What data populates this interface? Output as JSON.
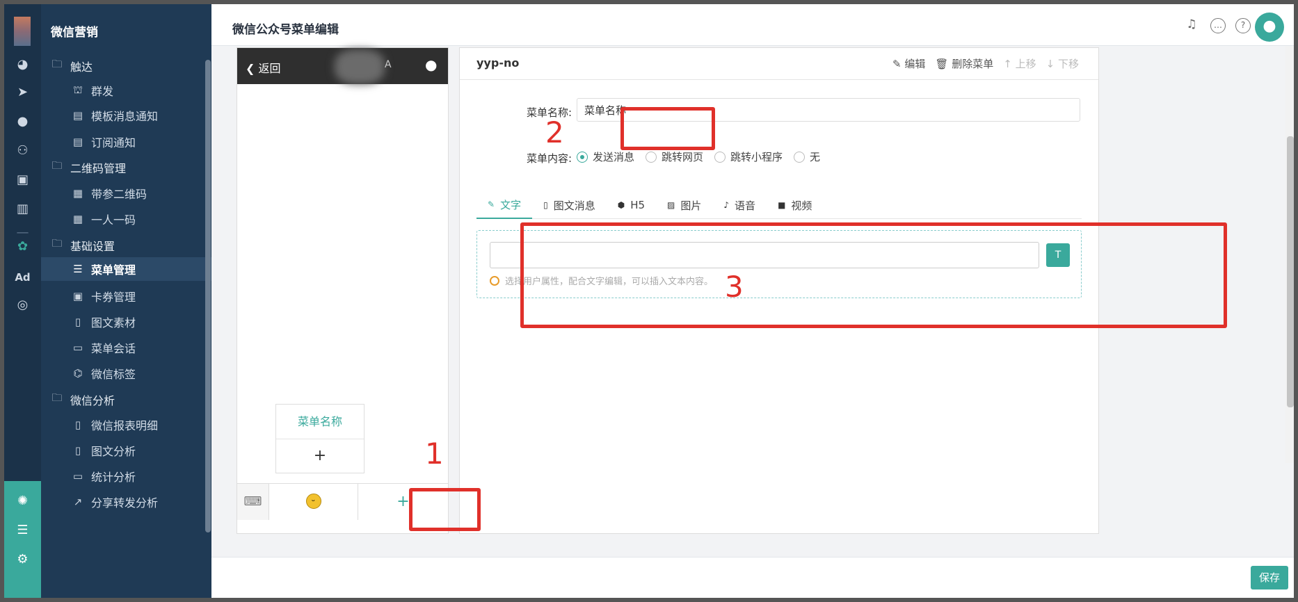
{
  "app": {
    "brand": "微信营销",
    "page_title": "微信公众号菜单编辑"
  },
  "colors": {
    "accent": "#3aa99c",
    "sidebar": "#1f3a55",
    "annotation": "#e0302a"
  },
  "iconbar": {
    "icons": [
      "dashboard-icon",
      "send-icon",
      "user-icon",
      "users-icon",
      "bookmark-icon",
      "bar-chart-icon",
      "wechat-icon",
      "ad-icon",
      "target-icon",
      "flower-icon",
      "server-icon",
      "gear-icon"
    ],
    "ad_label": "Ad"
  },
  "sidebar": {
    "groups": [
      {
        "label": "触达",
        "items": [
          "群发",
          "模板消息通知",
          "订阅通知"
        ]
      },
      {
        "label": "二维码管理",
        "items": [
          "带参二维码",
          "一人一码"
        ]
      },
      {
        "label": "基础设置",
        "items": [
          "菜单管理",
          "卡券管理",
          "图文素材",
          "菜单会话",
          "微信标签"
        ]
      },
      {
        "label": "微信分析",
        "items": [
          "微信报表明细",
          "图文分析",
          "统计分析",
          "分享转发分析"
        ]
      }
    ],
    "active": "菜单管理"
  },
  "topbar": {
    "icons": [
      "bell-icon",
      "chat-icon",
      "help-icon"
    ]
  },
  "phone": {
    "back_label": "返回",
    "title_fragment": "A",
    "submenu_name": "菜单名称",
    "submenu_add": "+",
    "menu_add": "+"
  },
  "editor": {
    "title": "yyp-no",
    "actions": {
      "edit": "编辑",
      "delete": "删除菜单",
      "up": "上移",
      "down": "下移"
    },
    "name_label": "菜单名称:",
    "name_value": "菜单名称",
    "content_label": "菜单内容:",
    "content_options": [
      "发送消息",
      "跳转网页",
      "跳转小程序",
      "无"
    ],
    "content_selected": "发送消息",
    "tabs": [
      "文字",
      "图文消息",
      "H5",
      "图片",
      "语音",
      "视频"
    ],
    "active_tab": "文字",
    "hint": "选择用户属性，配合文字编辑，可以插入文本内容。"
  },
  "annotations": [
    "1",
    "2",
    "3"
  ],
  "footer": {
    "save_label": "保存"
  }
}
